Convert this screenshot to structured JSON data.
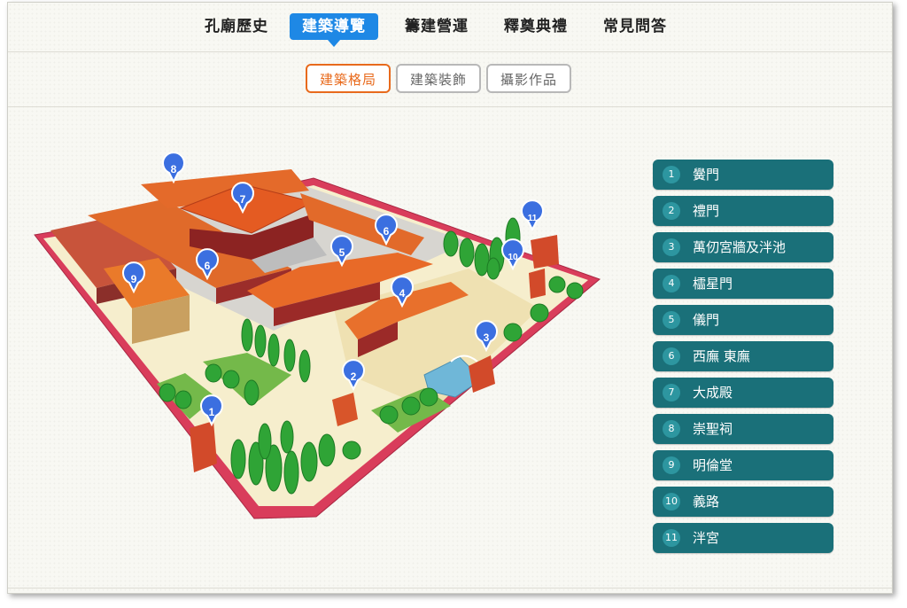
{
  "nav": {
    "items": [
      {
        "label": "孔廟歷史"
      },
      {
        "label": "建築導覽"
      },
      {
        "label": "籌建營運"
      },
      {
        "label": "釋奠典禮"
      },
      {
        "label": "常見問答"
      }
    ],
    "active_index": 1
  },
  "subtabs": {
    "items": [
      {
        "label": "建築格局"
      },
      {
        "label": "建築裝飾"
      },
      {
        "label": "攝影作品"
      }
    ],
    "active_index": 0
  },
  "legend": {
    "items": [
      {
        "num": "1",
        "label": "黌門"
      },
      {
        "num": "2",
        "label": "禮門"
      },
      {
        "num": "3",
        "label": "萬仞宮牆及泮池"
      },
      {
        "num": "4",
        "label": "櫺星門"
      },
      {
        "num": "5",
        "label": "儀門"
      },
      {
        "num": "6",
        "label": "西廡 東廡"
      },
      {
        "num": "7",
        "label": "大成殿"
      },
      {
        "num": "8",
        "label": "崇聖祠"
      },
      {
        "num": "9",
        "label": "明倫堂"
      },
      {
        "num": "10",
        "label": "義路"
      },
      {
        "num": "11",
        "label": "泮宮"
      }
    ]
  },
  "map_pins": [
    "1",
    "2",
    "3",
    "4",
    "5",
    "6",
    "6",
    "7",
    "8",
    "9",
    "10",
    "11"
  ],
  "colors": {
    "nav_active": "#1e88e5",
    "subtab_active": "#e86a1c",
    "legend_bg": "#1a7079",
    "legend_badge": "#2d96a0",
    "pin": "#3b6fe0"
  }
}
